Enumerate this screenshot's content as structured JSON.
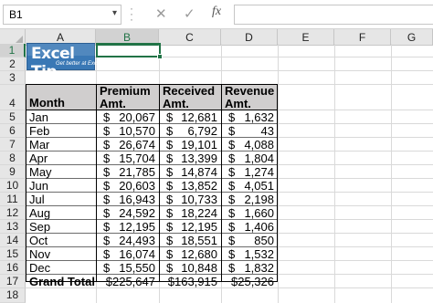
{
  "formula_bar": {
    "name_box": "B1",
    "name_box_arrow": "▾",
    "cancel_symbol": "✕",
    "enter_symbol": "✓",
    "fx_label": "fx",
    "formula": ""
  },
  "columns": [
    "A",
    "B",
    "C",
    "D",
    "E",
    "F",
    "G"
  ],
  "rows": [
    "1",
    "2",
    "3",
    "4",
    "5",
    "6",
    "7",
    "8",
    "9",
    "10",
    "11",
    "12",
    "13",
    "14",
    "15",
    "16",
    "17",
    "18"
  ],
  "logo": {
    "title": "Excel Tip",
    "subtitle": "Get better at Excel"
  },
  "table": {
    "headers": {
      "month": "Month",
      "premium_1": "Premium",
      "premium_2": "Amt.",
      "received_1": "Received",
      "received_2": "Amt.",
      "revenue_1": "Revenue",
      "revenue_2": "Amt."
    },
    "currency": "$",
    "rows": [
      {
        "month": "Jan",
        "premium": "20,067",
        "received": "12,681",
        "revenue": "1,632"
      },
      {
        "month": "Feb",
        "premium": "10,570",
        "received": "6,792",
        "revenue": "43"
      },
      {
        "month": "Mar",
        "premium": "26,674",
        "received": "19,101",
        "revenue": "4,088"
      },
      {
        "month": "Apr",
        "premium": "15,704",
        "received": "13,399",
        "revenue": "1,804"
      },
      {
        "month": "May",
        "premium": "21,785",
        "received": "14,874",
        "revenue": "1,274"
      },
      {
        "month": "Jun",
        "premium": "20,603",
        "received": "13,852",
        "revenue": "4,051"
      },
      {
        "month": "Jul",
        "premium": "16,943",
        "received": "10,733",
        "revenue": "2,198"
      },
      {
        "month": "Aug",
        "premium": "24,592",
        "received": "18,224",
        "revenue": "1,660"
      },
      {
        "month": "Sep",
        "premium": "12,195",
        "received": "12,195",
        "revenue": "1,406"
      },
      {
        "month": "Oct",
        "premium": "24,493",
        "received": "18,551",
        "revenue": "850"
      },
      {
        "month": "Nov",
        "premium": "16,074",
        "received": "12,680",
        "revenue": "1,532"
      },
      {
        "month": "Dec",
        "premium": "15,550",
        "received": "10,848",
        "revenue": "1,832"
      }
    ],
    "total": {
      "label": "Grand Total",
      "premium": "$225,647",
      "received": "$163,915",
      "revenue": "$25,326"
    }
  },
  "colors": {
    "selection": "#217346",
    "header_fill": "#d0cece",
    "logo_blue": "#3a78b5"
  }
}
